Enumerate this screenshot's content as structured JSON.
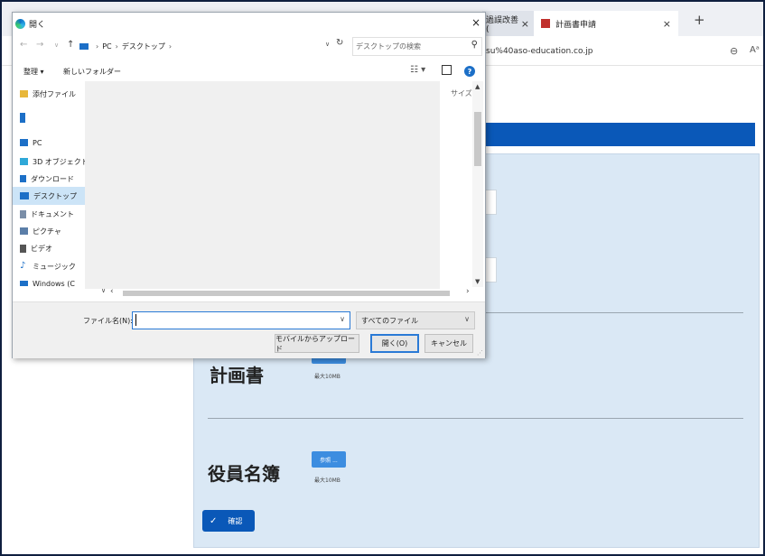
{
  "browser": {
    "tabs": [
      {
        "label": "過誤改善(",
        "close": "×"
      },
      {
        "label": "計画書申請",
        "close": "×"
      }
    ],
    "new_tab": "+",
    "url_fragment": "su%40aso-education.co.jp",
    "zoom_icon": "zoom-icon",
    "read_aloud": "Aᵃ"
  },
  "page": {
    "label_plan": "計画書",
    "label_officers": "役員名簿",
    "browse_label": "参照 ...",
    "max_size": "最大10MB",
    "confirm_label": "確認",
    "confirm_check": "✓"
  },
  "dialog": {
    "title": "開く",
    "close": "×",
    "nav": {
      "back": "←",
      "forward": "→",
      "down": "∨",
      "up": "↑"
    },
    "breadcrumb": [
      "PC",
      "デスクトップ"
    ],
    "crumb_sep": "›",
    "search_placeholder": "デスクトップの検索",
    "toolbar": {
      "organize": "整理 ▾",
      "new_folder": "新しいフォルダー",
      "view": "☷ ▾",
      "help": "?"
    },
    "nav_items": [
      {
        "label": "添付ファイル",
        "icon": "folder-icon",
        "color": "#e8b73a"
      },
      {
        "label": "",
        "icon": "building-icon",
        "color": "#1c6fc7"
      },
      {
        "label": "PC",
        "icon": "pc-icon",
        "color": "#1c6fc7"
      },
      {
        "label": "3D オブジェクト",
        "icon": "cube-icon",
        "color": "#2fa8d8"
      },
      {
        "label": "ダウンロード",
        "icon": "download-icon",
        "color": "#1c6fc7"
      },
      {
        "label": "デスクトップ",
        "icon": "desktop-icon",
        "color": "#1c6fc7",
        "selected": true
      },
      {
        "label": "ドキュメント",
        "icon": "document-icon",
        "color": "#7a8ea8"
      },
      {
        "label": "ピクチャ",
        "icon": "picture-icon",
        "color": "#5b7ea8"
      },
      {
        "label": "ビデオ",
        "icon": "video-icon",
        "color": "#555555"
      },
      {
        "label": "ミュージック",
        "icon": "music-icon",
        "color": "#1c6fc7"
      },
      {
        "label": "Windows (C",
        "icon": "drive-icon",
        "color": "#1c6fc7"
      }
    ],
    "column_size": "サイズ",
    "filename_label": "ファイル名(N):",
    "filename_value": "",
    "filetype_value": "すべてのファイル",
    "buttons": {
      "mobile_upload": "モバイルからアップロード",
      "open": "開く(O)",
      "cancel": "キャンセル"
    }
  }
}
